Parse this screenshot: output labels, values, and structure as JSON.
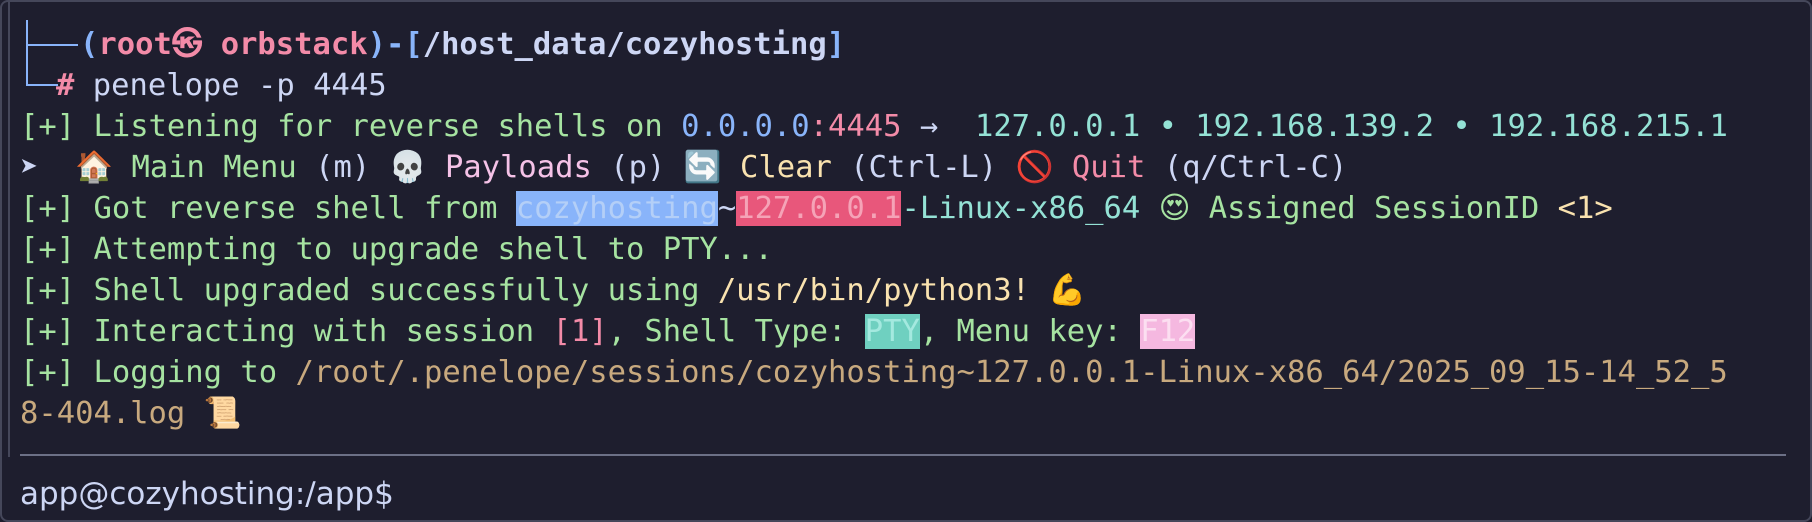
{
  "prompt": {
    "open_paren": "(",
    "user": "root",
    "at_symbol": "㉿",
    "host": "orbstack",
    "close_dash": ")-[",
    "path": "/host_data/cozyhosting",
    "close_bracket": "]",
    "hash": "#",
    "command": "penelope -p 4445"
  },
  "listening": {
    "prefix": "[+]",
    "text": "Listening for reverse shells on",
    "ip": "0.0.0.0",
    "port": ":4445",
    "arrow": "→",
    "addresses": "127.0.0.1 • 192.168.139.2 • 192.168.215.1"
  },
  "menu": {
    "pointer": "➤",
    "home_icon": "🏠",
    "main_menu": "Main Menu",
    "main_key": "(m)",
    "skull_icon": "💀",
    "payloads": "Payloads",
    "payloads_key": "(p)",
    "refresh_icon": "🔄",
    "clear": "Clear",
    "clear_key": "(Ctrl-L)",
    "prohibited_icon": "🚫",
    "quit": "Quit",
    "quit_key": "(q/Ctrl-C)"
  },
  "got_shell": {
    "prefix": "[+]",
    "text": "Got reverse shell from",
    "hostname": "cozyhosting",
    "tilde": "~",
    "ip": "127.0.0.1",
    "arch": "-Linux-x86_64",
    "heart_eyes_icon": "😍",
    "assigned": "Assigned SessionID",
    "session_id": "<1>"
  },
  "attempting": {
    "prefix": "[+]",
    "text": "Attempting to upgrade shell to PTY..."
  },
  "upgraded": {
    "prefix": "[+]",
    "text": "Shell upgraded successfully using",
    "binary": "/usr/bin/python3!",
    "muscle_icon": "💪"
  },
  "interacting": {
    "prefix": "[+]",
    "text": "Interacting with session",
    "session": "[1]",
    "shell_type_label": ", Shell Type:",
    "shell_type": "PTY",
    "menu_key_label": ", Menu key:",
    "menu_key": "F12"
  },
  "logging": {
    "prefix": "[+]",
    "text": "Logging to",
    "path_line1": "/root/.penelope/sessions/cozyhosting~127.0.0.1-Linux-x86_64/2025_09_15-14_52_5",
    "path_line2": "8-404.log",
    "scroll_icon": "📜"
  },
  "shell_prompt": "app@cozyhosting:/app$"
}
